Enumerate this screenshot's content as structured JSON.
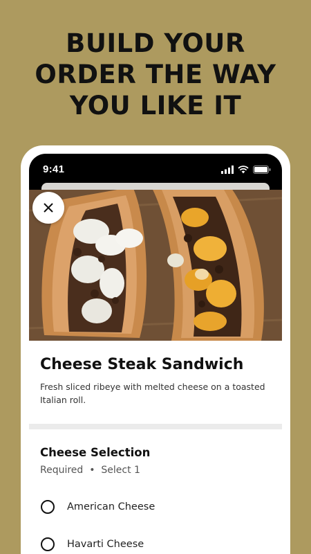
{
  "headline": [
    "BUILD YOUR",
    "ORDER THE WAY",
    "YOU LIKE IT"
  ],
  "status_bar": {
    "time": "9:41"
  },
  "colors": {
    "background": "#ad9a5f",
    "phone_frame": "#ffffff"
  },
  "item": {
    "title": "Cheese Steak Sandwich",
    "description": "Fresh sliced ribeye with melted cheese on a toasted Italian roll."
  },
  "cheese_section": {
    "title": "Cheese Selection",
    "subtitle": "Required  •  Select 1",
    "options": [
      {
        "label": "American Cheese",
        "selected": false
      },
      {
        "label": "Havarti Cheese",
        "selected": false
      }
    ]
  },
  "icons": {
    "close": "close-icon",
    "signal": "cellular-signal-icon",
    "wifi": "wifi-icon",
    "battery": "battery-icon"
  }
}
